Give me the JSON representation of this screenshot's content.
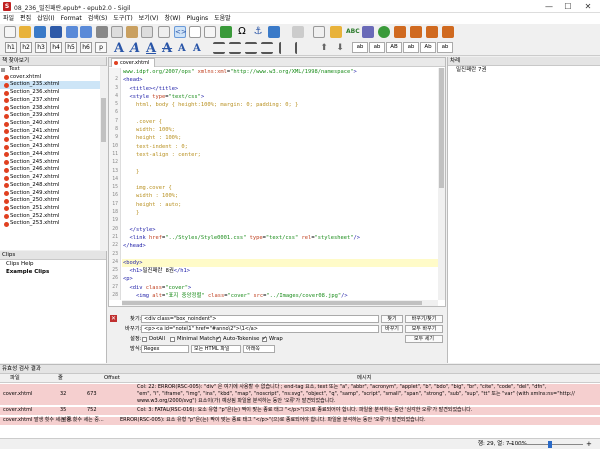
{
  "window": {
    "title": "08_236_밀진패란.epub* - epub2.0 - Sigil",
    "app_letter": "S",
    "minimize": "—",
    "maximize": "☐",
    "close": "✕"
  },
  "menu": [
    "파일",
    "편집",
    "삽입(I)",
    "Format",
    "검색(S)",
    "도구(T)",
    "보기(V)",
    "창(W)",
    "Plugins",
    "도움말"
  ],
  "heading_buttons": [
    "h1",
    "h2",
    "h3",
    "h4",
    "h5",
    "h6",
    "p"
  ],
  "format_buttons": [
    "ab",
    "ab",
    "AB",
    "ab",
    "Ab",
    "ab"
  ],
  "left_panel": {
    "title": "책 찾아보기",
    "root": "Text",
    "files": [
      "cover.xhtml",
      "Section_235.xhtml",
      "Section_236.xhtml",
      "Section_237.xhtml",
      "Section_238.xhtml",
      "Section_239.xhtml",
      "Section_240.xhtml",
      "Section_241.xhtml",
      "Section_242.xhtml",
      "Section_243.xhtml",
      "Section_244.xhtml",
      "Section_245.xhtml",
      "Section_246.xhtml",
      "Section_247.xhtml",
      "Section_248.xhtml",
      "Section_249.xhtml",
      "Section_250.xhtml",
      "Section_251.xhtml",
      "Section_252.xhtml",
      "Section_253.xhtml"
    ],
    "selected_index": 1
  },
  "clips": {
    "title": "Clips",
    "items": [
      "Clips Help",
      "Example Clips"
    ]
  },
  "editor": {
    "tab_label": "cover.xhtml",
    "line_numbers": [
      "",
      "2",
      "3",
      "4",
      "5",
      "6",
      "7",
      "8",
      "9",
      "10",
      "11",
      "12",
      "13",
      "14",
      "15",
      "16",
      "17",
      "18",
      "19",
      "20",
      "21",
      "22",
      "23",
      "24",
      "25",
      "26",
      "27",
      "28"
    ],
    "current_line": 22
  },
  "find": {
    "find_label": "찾기:",
    "find_value": "<div class=\"box_noindent\">",
    "replace_label": "바꾸기:",
    "replace_value": "<p><a id=\"note\\1\" href=\"#anno\\2\">\\1</a>",
    "find_btn": "찾기",
    "replace_find_btn": "바꾸기/찾기",
    "replace_btn": "바꾸기",
    "replace_all_btn": "모두 바꾸기",
    "count_btn": "모두 세기",
    "options_label": "설정:",
    "dotall": "DotAll",
    "minimal": "Minimal Match",
    "autotokenise": "Auto-Tokenise",
    "wrap": "Wrap",
    "mode_label": "방식:",
    "mode": "Regex",
    "scope": "모든 HTML 파일",
    "direction": "아래쪽"
  },
  "right_panel": {
    "title": "차례",
    "item": "밀진패란 7권"
  },
  "validation": {
    "title": "유효성 검사 결과",
    "headers": [
      "파일",
      "줄",
      "Offset",
      "메시지"
    ],
    "rows": [
      {
        "file": "cover.xhtml",
        "line": "32",
        "offset": "673",
        "msg1": "Col: 22: ERROR(RSC-005): \"div\" 은 여기에 사용할 수 없습니다 ; end-tag 요소, text 또는 \"a\", \"abbr\", \"acronym\", \"applet\", \"b\", \"bdo\", \"big\", \"br\", \"cite\", \"code\", \"del\", \"dfn\",",
        "msg2": "\"em\", \"i\", \"iframe\", \"img\", \"ins\", \"kbd\", \"map\", \"noscript\", \"ns:svg\", \"object\", \"q\", \"samp\", \"script\", \"small\", \"span\", \"strong\", \"sub\", \"sup\", \"tt\" 또는 \"var\" (with xmlns:ns=\"http://",
        "msg3": "www.w3.org/2000/svg\") 요소이(가) 예상됨 파일을 분석하는 동안 '오류'가 발견되었습니다."
      },
      {
        "file": "cover.xhtml",
        "line": "35",
        "offset": "752",
        "msg1": "Col: 3: FATAL(RSC-016): 요소 유형 \"p\"은(는) 짝이 맞는 종료 태그 \"</p>\"(으)로 종료되어야 합니다. 파일을 분석하는 동안 '심각한 오류'가 발견되었습니다."
      },
      {
        "file": "cover.xhtml 발생 횟수 세는 중...",
        "line": "발생 횟수 세는 중...",
        "offset": "ERROR(RSC-005): 요소 유형 \"p\"은(는) 짝이 맞는 종료 태그 \"</p>\"(으)로 종료되어야 합니다. 파일을 분석하는 동안 '오류'가 발견되었습니다."
      }
    ]
  },
  "status": {
    "text": "행: 29, 열: 7  100%"
  },
  "colors": {
    "tag": "#1a1aa6",
    "attr": "#c04020",
    "value": "#1a8c1a",
    "error_row": "#f5cfcf",
    "accent": "#2a56a8"
  }
}
